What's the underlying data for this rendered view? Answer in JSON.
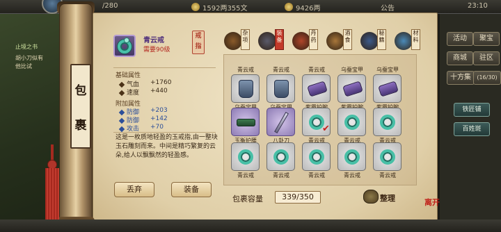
{
  "status_bar": {
    "stamina": "/280",
    "silver": "1592两355文",
    "gold": "9426两",
    "announcement": "公告",
    "clock": "23:10",
    "extra_value": "10"
  },
  "left_panel": {
    "line1": "止境之书",
    "line2": "胡小刀似有",
    "line3": "他比试"
  },
  "right_menu": {
    "buttons": [
      "活动",
      "聚宝",
      "商城",
      "驻区"
    ],
    "counter": "十方集",
    "counter_value": "(16/30)",
    "smith": "铁匠铺",
    "pawn": "百姓斑"
  },
  "scroll_title": [
    "包",
    "裹"
  ],
  "selected_item": {
    "name": "青云戒",
    "requirement": "需要90级",
    "type_tag": [
      "戒",
      "指"
    ],
    "base_title": "基础属性",
    "base_attrs": [
      {
        "label": "气血",
        "value": "+1760"
      },
      {
        "label": "速度",
        "value": "+440"
      }
    ],
    "extra_title": "附加属性",
    "extra_attrs": [
      {
        "label": "防御",
        "value": "+203"
      },
      {
        "label": "防御",
        "value": "+142"
      },
      {
        "label": "攻击",
        "value": "+70"
      }
    ],
    "description": "这是一枚质地轻盈的玉戒指,由一整块玉石雕刻而来。中间是精巧繁复的云朵,给人以飘飘然的轻盈感。",
    "discard_label": "丢弃",
    "equip_label": "装备"
  },
  "tabs": [
    {
      "label": "杂项",
      "icon": "pot-icon"
    },
    {
      "label": "装备",
      "icon": "equipment-icon"
    },
    {
      "label": "丹药",
      "icon": "pill-icon"
    },
    {
      "label": "酒食",
      "icon": "wine-icon"
    },
    {
      "label": "秘籍",
      "icon": "book-icon"
    },
    {
      "label": "材料",
      "icon": "crystal-icon"
    }
  ],
  "inventory": {
    "partial_row_labels": [
      "青云戒",
      "青云戒",
      "青云戒",
      "乌蚕宝甲",
      "乌蚕宝甲"
    ],
    "rows": [
      [
        {
          "name": "乌蚕宝甲",
          "kind": "armor"
        },
        {
          "name": "乌蚕宝甲",
          "kind": "armor"
        },
        {
          "name": "紫霞护腕",
          "kind": "bracer"
        },
        {
          "name": "紫霞护腕",
          "kind": "bracer"
        },
        {
          "name": "紫霞护腕",
          "kind": "bracer"
        }
      ],
      [
        {
          "name": "玉衡护腰",
          "kind": "belt"
        },
        {
          "name": "八卦刀",
          "kind": "blade"
        },
        {
          "name": "青云戒",
          "kind": "ring",
          "equipped": true
        },
        {
          "name": "青云戒",
          "kind": "ring"
        },
        {
          "name": "青云戒",
          "kind": "ring"
        }
      ],
      [
        {
          "name": "青云戒",
          "kind": "ring"
        },
        {
          "name": "青云戒",
          "kind": "ring"
        },
        {
          "name": "青云戒",
          "kind": "ring"
        },
        {
          "name": "青云戒",
          "kind": "ring"
        },
        {
          "name": "青云戒",
          "kind": "ring"
        }
      ]
    ]
  },
  "capacity": {
    "label": "包裹容量",
    "value": "339/350"
  },
  "sort_label": "整理",
  "seal_text": "离开"
}
